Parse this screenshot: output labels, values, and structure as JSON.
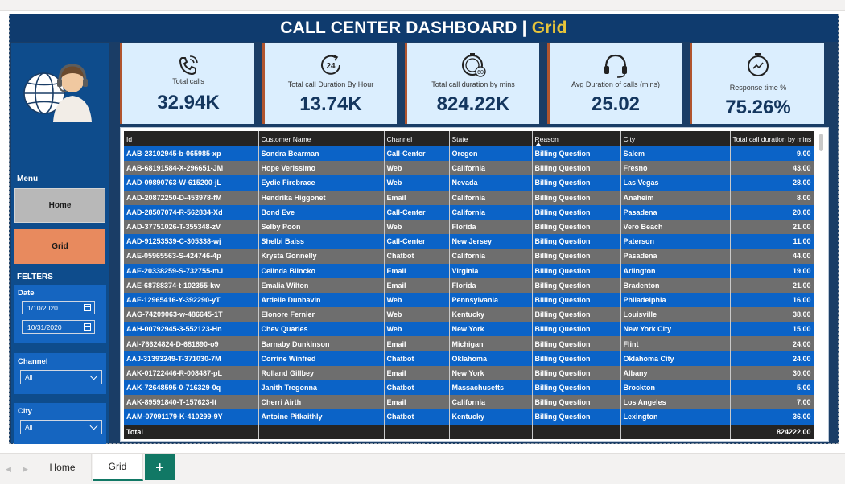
{
  "header": {
    "title_main": "CALL CENTER DASHBOARD | ",
    "title_page": "Grid"
  },
  "sidebar": {
    "menu_label": "Menu",
    "nav": [
      {
        "label": "Home"
      },
      {
        "label": "Grid"
      }
    ],
    "filters_label": "FELTERS",
    "date": {
      "label": "Date",
      "start": "1/10/2020",
      "end": "10/31/2020"
    },
    "channel": {
      "label": "Channel",
      "value": "All"
    },
    "city": {
      "label": "City",
      "value": "All"
    }
  },
  "kpis": [
    {
      "label": "Total calls",
      "value": "32.94K",
      "icon": "phone-ringing-icon"
    },
    {
      "label": "Total call Duration By Hour",
      "value": "13.74K",
      "icon": "clock-24-icon"
    },
    {
      "label": "Total call duration by mins",
      "value": "824.22K",
      "icon": "timer-60-icon"
    },
    {
      "label": "Avg Duration of calls (mins)",
      "value": "25.02",
      "icon": "headset-icon"
    },
    {
      "label": "Response time %",
      "value": "75.26%",
      "icon": "stopwatch-icon"
    }
  ],
  "table": {
    "columns": [
      "Id",
      "Customer Name",
      "Channel",
      "State",
      "Reason",
      "City",
      "Total call duration by mins"
    ],
    "rows": [
      [
        "AAB-23102945-b-065985-xp",
        "Sondra Bearman",
        "Call-Center",
        "Oregon",
        "Billing Question",
        "Salem",
        "9.00"
      ],
      [
        "AAB-68191584-X-296651-JM",
        "Hope Verissimo",
        "Web",
        "California",
        "Billing Question",
        "Fresno",
        "43.00"
      ],
      [
        "AAD-09890763-W-615200-jL",
        "Eydie Firebrace",
        "Web",
        "Nevada",
        "Billing Question",
        "Las Vegas",
        "28.00"
      ],
      [
        "AAD-20872250-D-453978-fM",
        "Hendrika Higgonet",
        "Email",
        "California",
        "Billing Question",
        "Anaheim",
        "8.00"
      ],
      [
        "AAD-28507074-R-562834-Xd",
        "Bond Eve",
        "Call-Center",
        "California",
        "Billing Question",
        "Pasadena",
        "20.00"
      ],
      [
        "AAD-37751026-T-355348-zV",
        "Selby Poon",
        "Web",
        "Florida",
        "Billing Question",
        "Vero Beach",
        "21.00"
      ],
      [
        "AAD-91253539-C-305338-wj",
        "Shelbi Baiss",
        "Call-Center",
        "New Jersey",
        "Billing Question",
        "Paterson",
        "11.00"
      ],
      [
        "AAE-05965563-S-424746-4p",
        "Krysta Gonnelly",
        "Chatbot",
        "California",
        "Billing Question",
        "Pasadena",
        "44.00"
      ],
      [
        "AAE-20338259-S-732755-mJ",
        "Celinda Blincko",
        "Email",
        "Virginia",
        "Billing Question",
        "Arlington",
        "19.00"
      ],
      [
        "AAE-68788374-t-102355-kw",
        "Emalia Wilton",
        "Email",
        "Florida",
        "Billing Question",
        "Bradenton",
        "21.00"
      ],
      [
        "AAF-12965416-Y-392290-yT",
        "Ardelle Dunbavin",
        "Web",
        "Pennsylvania",
        "Billing Question",
        "Philadelphia",
        "16.00"
      ],
      [
        "AAG-74209063-w-486645-1T",
        "Elonore Fernier",
        "Web",
        "Kentucky",
        "Billing Question",
        "Louisville",
        "38.00"
      ],
      [
        "AAH-00792945-3-552123-Hn",
        "Chev Quarles",
        "Web",
        "New York",
        "Billing Question",
        "New York City",
        "15.00"
      ],
      [
        "AAI-76624824-D-681890-o9",
        "Barnaby Dunkinson",
        "Email",
        "Michigan",
        "Billing Question",
        "Flint",
        "24.00"
      ],
      [
        "AAJ-31393249-T-371030-7M",
        "Corrine Winfred",
        "Chatbot",
        "Oklahoma",
        "Billing Question",
        "Oklahoma City",
        "24.00"
      ],
      [
        "AAK-01722446-R-008487-pL",
        "Rolland Gillbey",
        "Email",
        "New York",
        "Billing Question",
        "Albany",
        "30.00"
      ],
      [
        "AAK-72648595-0-716329-0q",
        "Janith Tregonna",
        "Chatbot",
        "Massachusetts",
        "Billing Question",
        "Brockton",
        "5.00"
      ],
      [
        "AAK-89591840-T-157623-lt",
        "Cherri Airth",
        "Email",
        "California",
        "Billing Question",
        "Los Angeles",
        "7.00"
      ],
      [
        "AAM-07091179-K-410299-9Y",
        "Antoine Pitkaithly",
        "Chatbot",
        "Kentucky",
        "Billing Question",
        "Lexington",
        "36.00"
      ]
    ],
    "total_label": "Total",
    "total_value": "824222.00"
  },
  "tabs": [
    {
      "label": "Home"
    },
    {
      "label": "Grid"
    }
  ],
  "add_tab": "+",
  "colors": {
    "title_accent": "#e8c53a",
    "row_blue": "#0b63c7",
    "row_gray": "#6e6e6e",
    "kpi_bg": "#dbeefe",
    "grid_btn": "#e88a5e"
  }
}
